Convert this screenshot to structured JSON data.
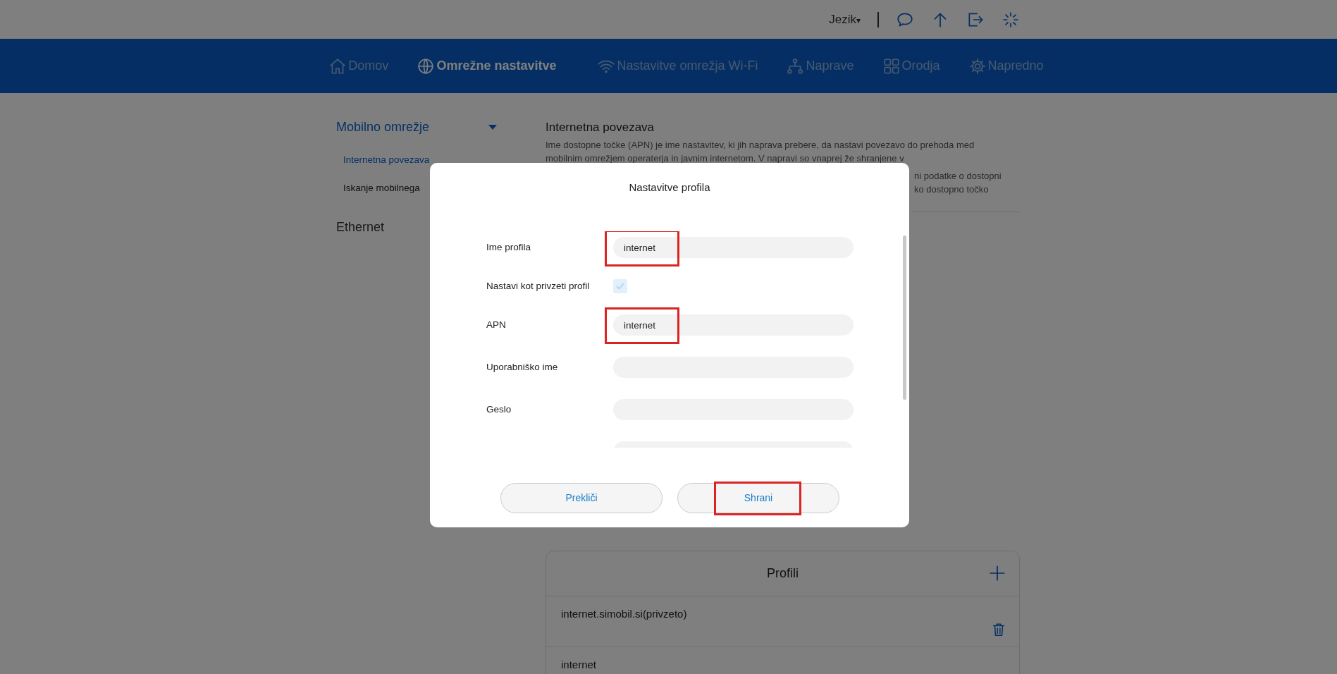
{
  "top_bar": {
    "language": {
      "label": "Jezik",
      "caret": "▾"
    }
  },
  "nav": {
    "items": [
      {
        "label": "Domov",
        "selected": false
      },
      {
        "label": "Omrežne nastavitve",
        "selected": true
      },
      {
        "label": "Nastavitve omrežja Wi-Fi",
        "selected": false
      },
      {
        "label": "Naprave",
        "selected": false
      },
      {
        "label": "Orodja",
        "selected": false
      },
      {
        "label": "Napredno",
        "selected": false
      }
    ]
  },
  "sidebar": {
    "groups": [
      {
        "label": "Mobilno omrežje",
        "expanded": true,
        "children": [
          {
            "label": "Internetna povezava",
            "selected": true
          },
          {
            "label": "Iskanje mobilnega",
            "selected": false
          }
        ]
      },
      {
        "label": "Ethernet",
        "expanded": false
      }
    ]
  },
  "main": {
    "title": "Internetna povezava",
    "description": [
      {
        "text": "Ime dostopne točke (APN) je ime nastavitev, ki jih naprava prebere, da nastavi povezavo do prehoda med",
        "kind": "full"
      },
      {
        "text": "mobilnim omrežjem operaterja in javnim internetom. V napravi so vnaprej že shranjene v",
        "kind": "full"
      },
      {
        "text": "ni podatke o dostopni",
        "kind": "tail"
      },
      {
        "text": "ko dostopno točko",
        "kind": "tail"
      }
    ],
    "profiles": {
      "title": "Profili",
      "rows": [
        {
          "label": "internet.simobil.si(privzeto)",
          "deletable": true
        },
        {
          "label": "internet",
          "deletable": false
        }
      ]
    }
  },
  "dialog": {
    "title": "Nastavitve profila",
    "fields": [
      {
        "kind": "text",
        "label": "Ime profila",
        "value": "internet",
        "highlighted": true
      },
      {
        "kind": "checkbox",
        "label": "Nastavi kot privzeti profil",
        "checked": true,
        "disabled": true
      },
      {
        "kind": "text",
        "label": "APN",
        "value": "internet",
        "highlighted": true
      },
      {
        "kind": "text",
        "label": "Uporabniško ime",
        "highlighted": false
      },
      {
        "kind": "text",
        "label": "Geslo",
        "highlighted": false
      },
      {
        "kind": "text"
      }
    ],
    "buttons": [
      {
        "label": "Prekliči",
        "highlighted": false
      },
      {
        "label": "Shrani",
        "highlighted": true
      }
    ]
  }
}
